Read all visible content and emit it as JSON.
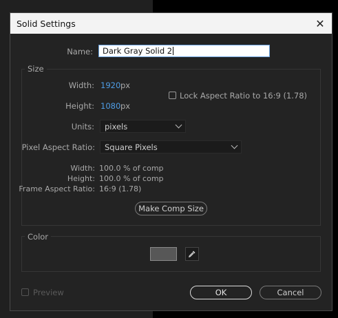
{
  "dialog": {
    "title": "Solid Settings",
    "close_symbol": "✕"
  },
  "name": {
    "label": "Name:",
    "value": "Dark Gray Solid 2"
  },
  "size": {
    "group_label": "Size",
    "width_label": "Width:",
    "width_value": "1920",
    "width_unit": "px",
    "height_label": "Height:",
    "height_value": "1080",
    "height_unit": "px",
    "lock_label": "Lock Aspect Ratio to 16:9 (1.78)",
    "lock_checked": false,
    "units_label": "Units:",
    "units_value": "pixels",
    "par_label": "Pixel Aspect Ratio:",
    "par_value": "Square Pixels",
    "info_width_label": "Width:",
    "info_width_value": "100.0 % of comp",
    "info_height_label": "Height:",
    "info_height_value": "100.0 % of comp",
    "info_far_label": "Frame Aspect Ratio:",
    "info_far_value": "16:9 (1.78)",
    "make_comp_size_label": "Make Comp Size"
  },
  "color": {
    "group_label": "Color",
    "swatch_hex": "#575757",
    "eyedropper_icon": "eyedropper-icon"
  },
  "footer": {
    "preview_label": "Preview",
    "preview_checked": false,
    "ok_label": "OK",
    "cancel_label": "Cancel"
  }
}
